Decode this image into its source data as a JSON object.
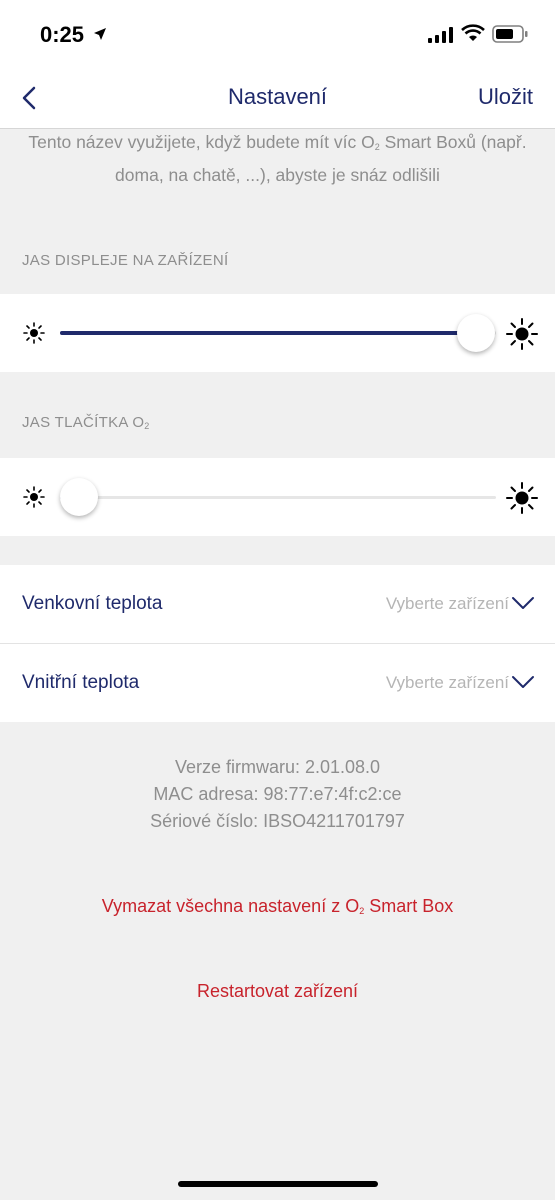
{
  "status_bar": {
    "time": "0:25"
  },
  "header": {
    "title": "Nastavení",
    "save_label": "Uložit"
  },
  "name_hint": {
    "text_before": "Tento název využijete, když budete mít víc O",
    "subscript": "2",
    "text_after": " Smart Boxů (např. doma, na chatě, ...), abyste je snáz odlišili"
  },
  "display_brightness": {
    "label": "JAS DISPLEJE NA ZAŘÍZENÍ",
    "value": 1.0
  },
  "button_brightness": {
    "label_before": "JAS TLAČÍTKA O",
    "label_sub": "2",
    "value": 0.0
  },
  "temperature": {
    "outdoor": {
      "label": "Venkovní teplota",
      "placeholder": "Vyberte zařízení"
    },
    "indoor": {
      "label": "Vnitřní teplota",
      "placeholder": "Vyberte zařízení"
    }
  },
  "device_info": {
    "firmware": "Verze firmwaru: 2.01.08.0",
    "mac": "MAC adresa: 98:77:e7:4f:c2:ce",
    "serial": "Sériové číslo: IBSO4211701797"
  },
  "actions": {
    "reset_before": "Vymazat všechna nastavení z O",
    "reset_sub": "2",
    "reset_after": " Smart Box",
    "restart": "Restartovat zařízení"
  },
  "colors": {
    "accent": "#1f2a6b",
    "danger": "#c8232c",
    "track_filled": "#1f2a6b",
    "track_empty": "#e6e6e6",
    "muted_text": "#8e8e8e"
  }
}
